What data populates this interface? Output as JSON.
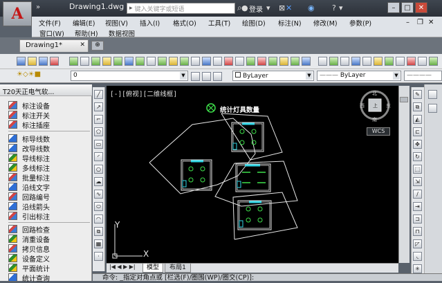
{
  "window": {
    "doc_title": "Drawing1.dwg",
    "search_placeholder": "键入关键字或短语",
    "login_label": "登录",
    "quick_access": "»",
    "help_label": "?"
  },
  "menu": {
    "row1": [
      "文件(F)",
      "编辑(E)",
      "视图(V)",
      "插入(I)",
      "格式(O)",
      "工具(T)",
      "绘图(D)",
      "标注(N)",
      "修改(M)",
      "参数(P)"
    ],
    "row2": [
      "窗口(W)",
      "帮助(H)",
      "数据视图"
    ]
  },
  "file_tabs": {
    "active": "Drawing1*"
  },
  "toolbar2": {
    "layer_value": "0",
    "color_value": "ByLayer",
    "linetype_value": "ByLayer"
  },
  "left_panel": {
    "title": "T20天正电气软...",
    "items": [
      "标注设备",
      "标注开关",
      "标注插座",
      "标导线数",
      "改导线数",
      "导线标注",
      "多线标注",
      "批量标注",
      "沿线文字",
      "回路编号",
      "沿线箭头",
      "引出标注",
      "回路检查",
      "消重设备",
      "拷贝信息",
      "设备定义",
      "平面统计",
      "统计查询"
    ]
  },
  "canvas": {
    "view_label": "[-][俯视][二维线框]",
    "drawing_title": "统计灯具数量",
    "compass": {
      "n": "北",
      "s": "南",
      "e": "东",
      "w": "西",
      "center": "上"
    },
    "wcs": "WCS",
    "ucs_x": "X",
    "ucs_y": "Y"
  },
  "layout_tabs": {
    "model": "模型",
    "layout1": "布局1"
  },
  "command_line": "命令: _指定对角点或 [栏选(F)/圈围(WP)/圈交(CP)]:"
}
